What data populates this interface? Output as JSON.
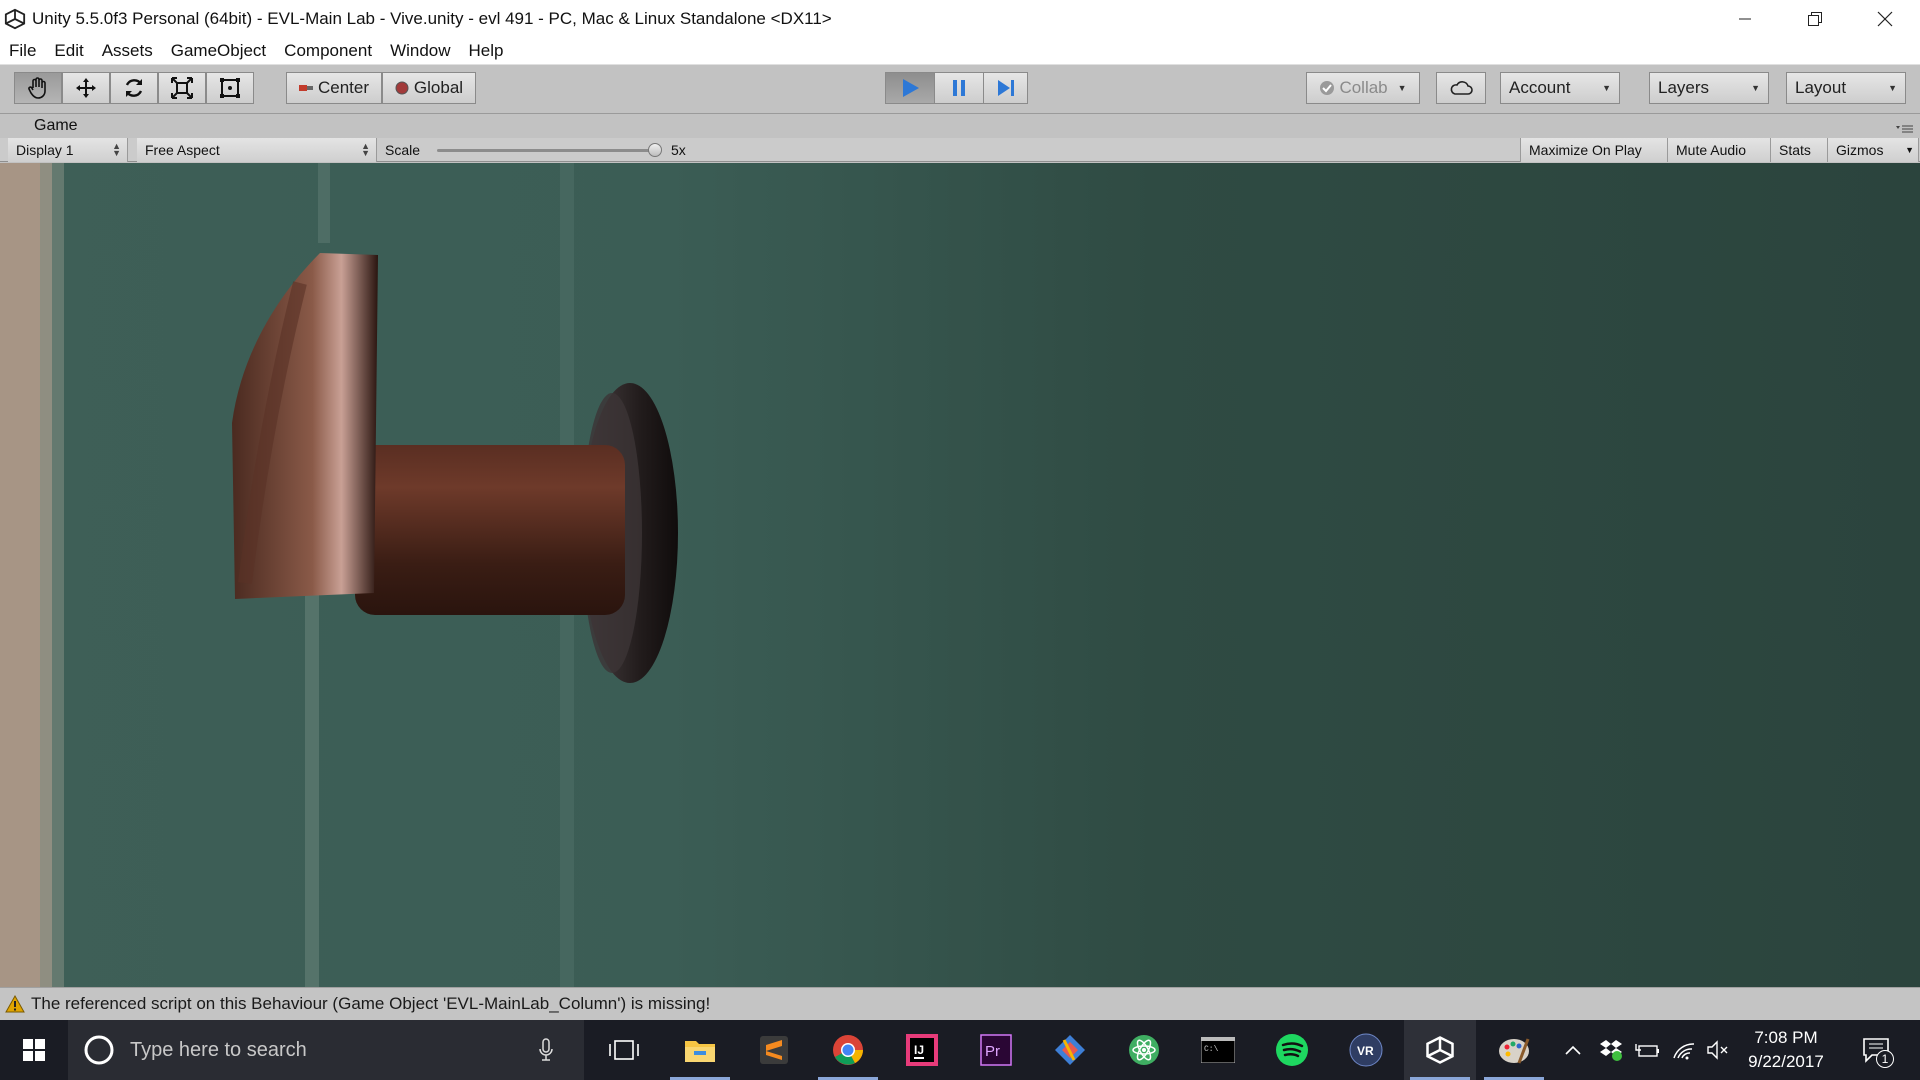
{
  "window": {
    "title": "Unity 5.5.0f3 Personal (64bit) - EVL-Main Lab - Vive.unity - evl 491 - PC, Mac & Linux Standalone <DX11>"
  },
  "menu": [
    "File",
    "Edit",
    "Assets",
    "GameObject",
    "Component",
    "Window",
    "Help"
  ],
  "toolbar": {
    "pivot_label": "Center",
    "space_label": "Global",
    "collab_label": "Collab",
    "account_label": "Account",
    "layers_label": "Layers",
    "layout_label": "Layout"
  },
  "game_tab": {
    "label": "Game",
    "display_label": "Display 1",
    "aspect_label": "Free Aspect",
    "scale_label": "Scale",
    "scale_value": "5x",
    "maximize_label": "Maximize On Play",
    "mute_label": "Mute Audio",
    "stats_label": "Stats",
    "gizmos_label": "Gizmos"
  },
  "status": {
    "message": "The referenced script on this Behaviour (Game Object 'EVL-MainLab_Column') is missing!"
  },
  "taskbar": {
    "search_placeholder": "Type here to search",
    "time": "7:08 PM",
    "date": "9/22/2017",
    "notification_count": "1"
  },
  "colors": {
    "play_active": "#2d78d6",
    "game_bg": "#2f4a44",
    "taskbar_bg": "#1a1c24"
  }
}
